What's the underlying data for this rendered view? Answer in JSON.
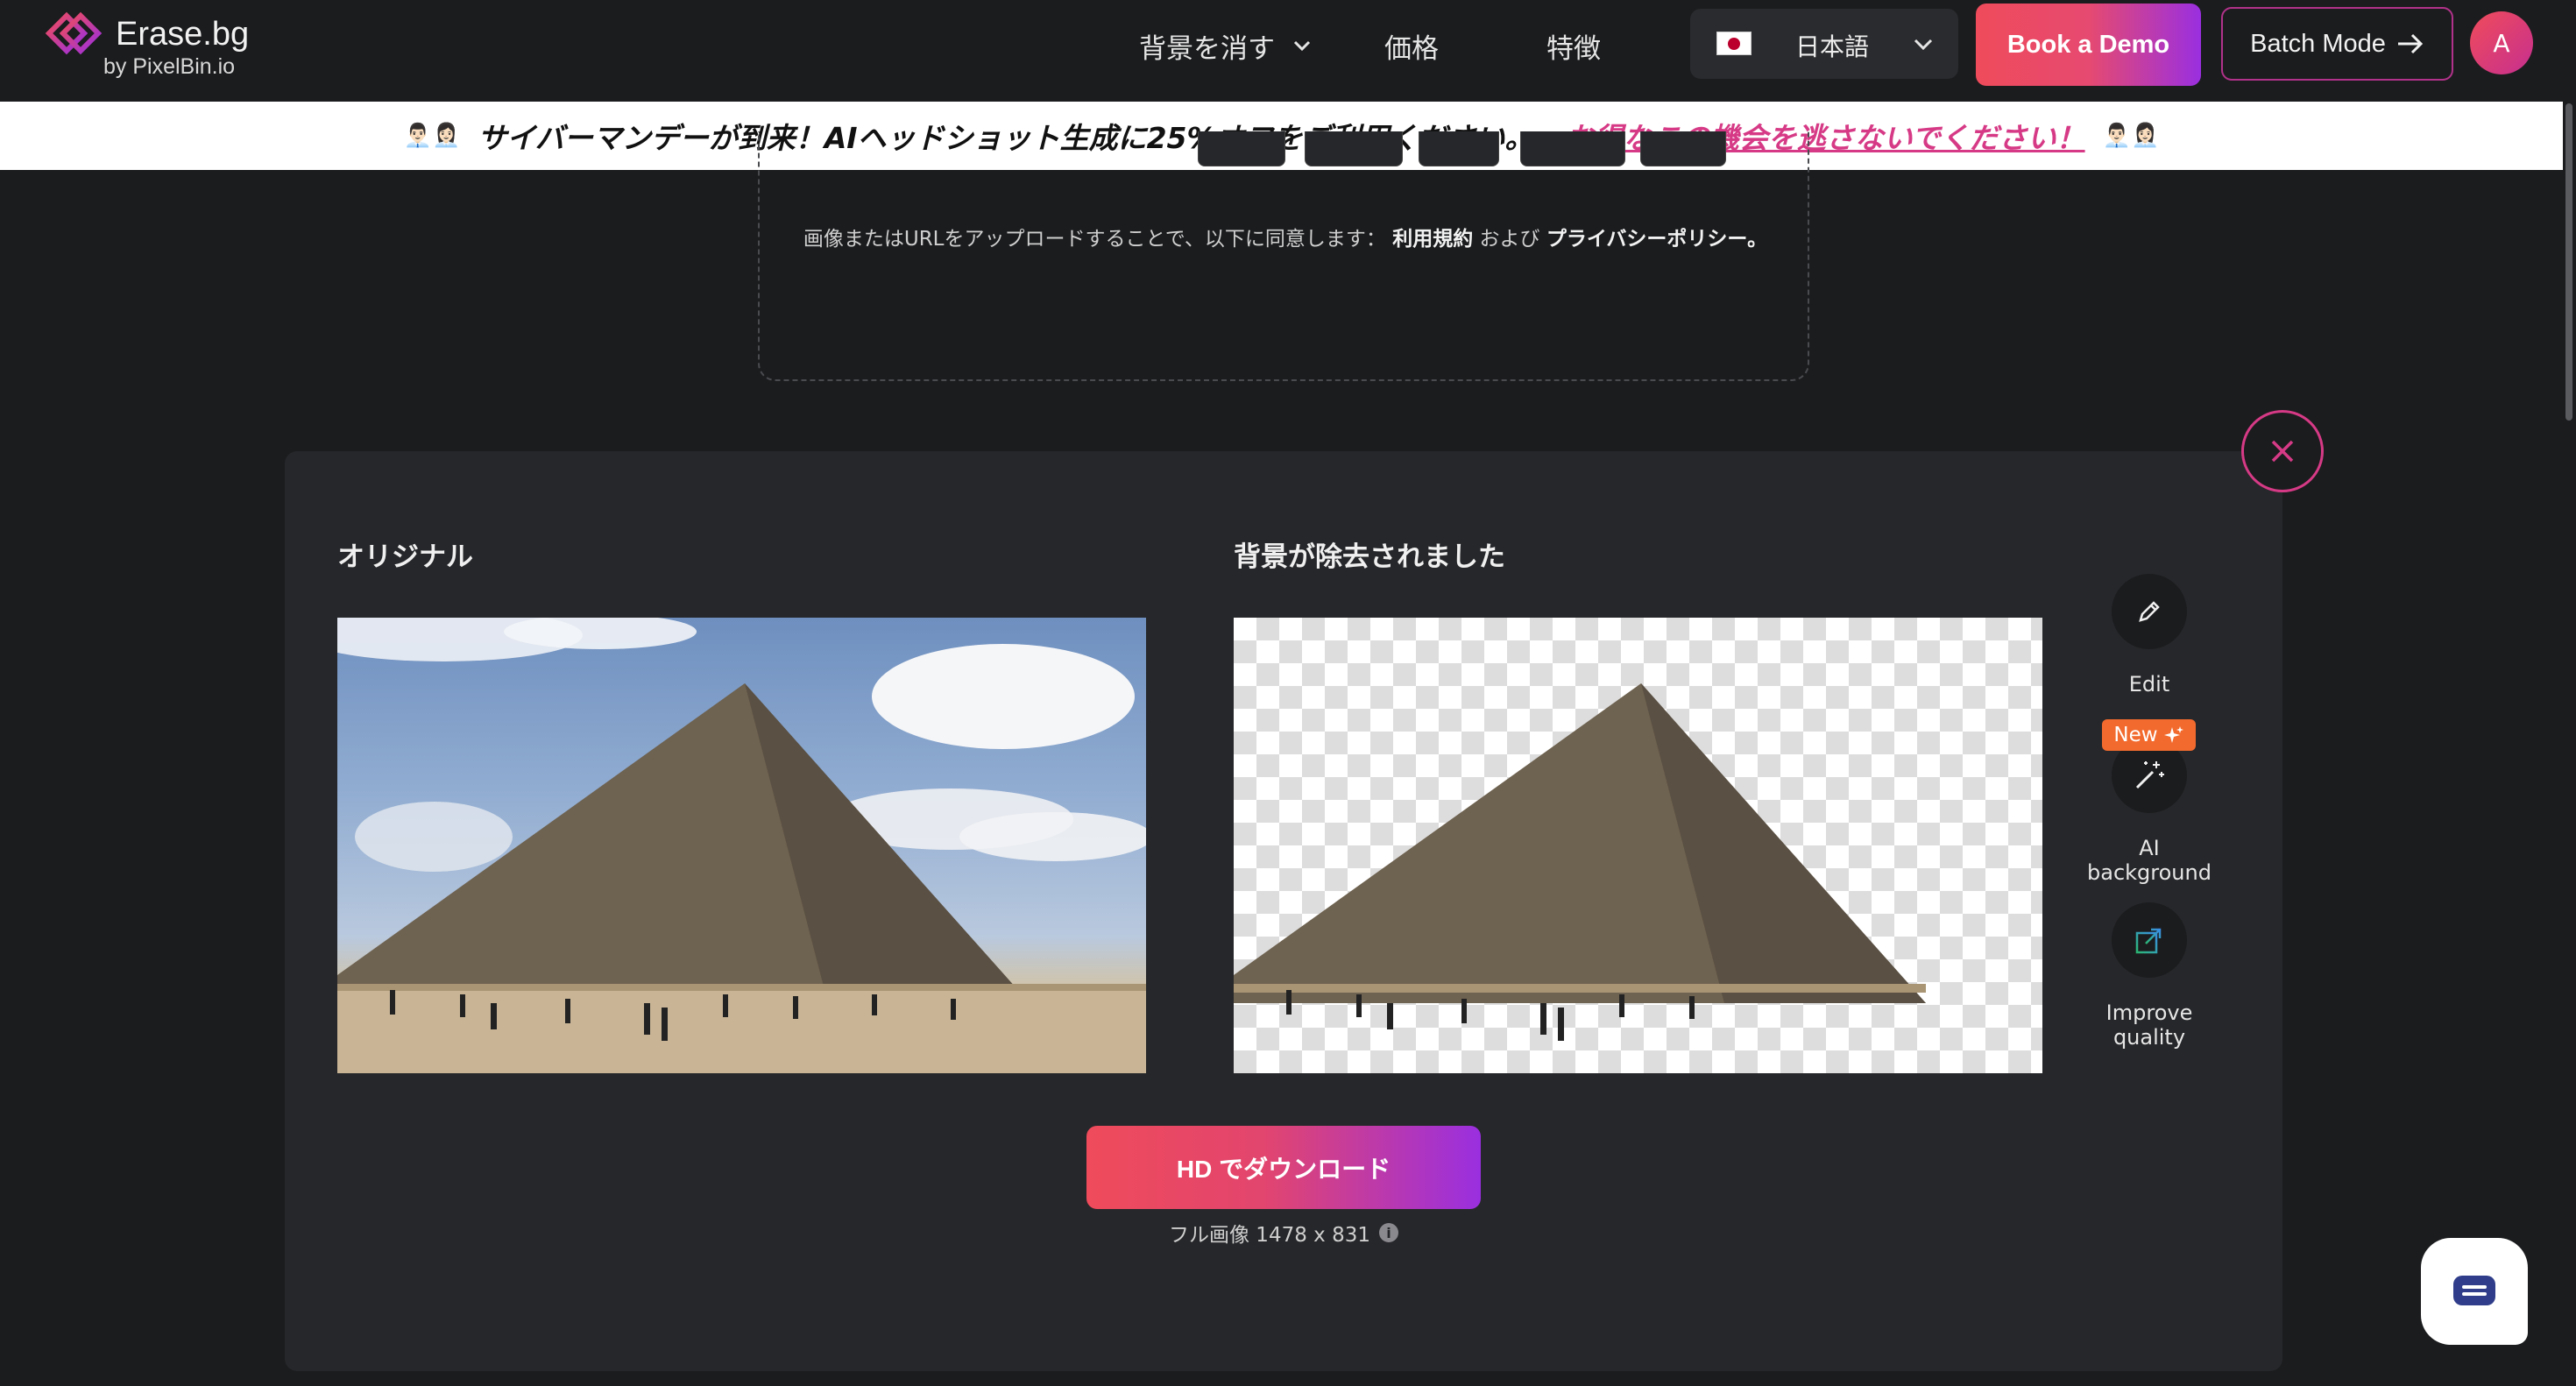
{
  "brand": {
    "title": "Erase.bg",
    "subtitle": "by PixelBin.io"
  },
  "nav": {
    "remove_bg": "背景を消す",
    "pricing": "価格",
    "features": "特徴"
  },
  "language": {
    "selected": "日本語"
  },
  "header_buttons": {
    "book_demo": "Book a Demo",
    "batch_mode": "Batch Mode",
    "avatar_initial": "A"
  },
  "banner": {
    "emoji_left": "👨🏻‍💼👩🏻‍💼",
    "text": "サイバーマンデーが到来！AIヘッドショット生成に25%オフをご利用ください。",
    "link": "お得なこの機会を逃さないでください！",
    "emoji_right": "👨🏻‍💼👩🏻‍💼"
  },
  "upload": {
    "consent_prefix": "画像またはURLをアップロードすることで、以下に同意します：",
    "terms": "利用規約",
    "and": "および",
    "privacy": "プライバシーポリシー。"
  },
  "result": {
    "original_title": "オリジナル",
    "removed_title": "背景が除去されました",
    "download_label": "HD でダウンロード",
    "full_image": "フル画像 1478 x 831"
  },
  "tools": {
    "edit": "Edit",
    "new_badge": "New",
    "ai_background": "AI background",
    "improve_quality": "Improve quality"
  },
  "colors": {
    "background": "#1b1c1e",
    "panel": "#26272a",
    "accent_pink": "#d63a86",
    "accent_gradient_start": "#ef4b5b",
    "accent_gradient_end": "#9a2fe0",
    "new_badge": "#f26a2e"
  },
  "icons": [
    "logo-icon",
    "chevron-down-icon",
    "flag-japan-icon",
    "arrow-right-icon",
    "close-icon",
    "pencil-icon",
    "magic-wand-icon",
    "sparkle-icon",
    "improve-quality-icon",
    "info-icon",
    "chat-icon"
  ]
}
